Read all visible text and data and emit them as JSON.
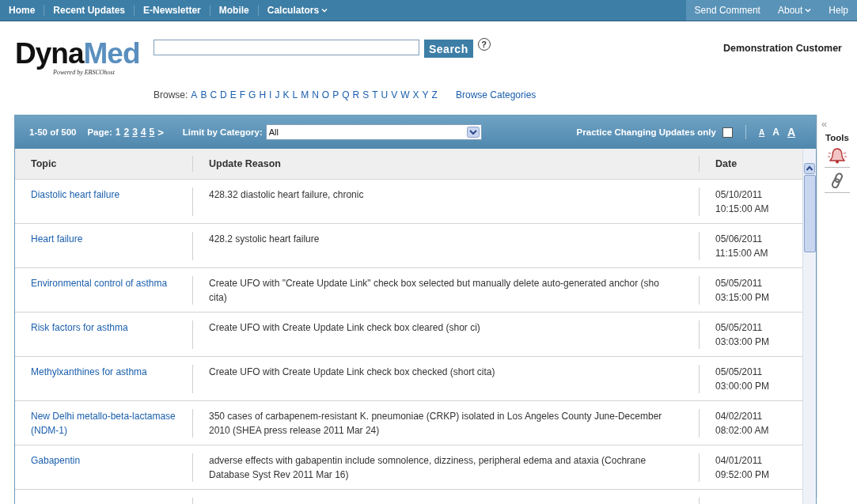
{
  "nav": {
    "left": [
      {
        "label": "Home",
        "dropdown": false
      },
      {
        "label": "Recent Updates",
        "dropdown": false
      },
      {
        "label": "E-Newsletter",
        "dropdown": false
      },
      {
        "label": "Mobile",
        "dropdown": false
      },
      {
        "label": "Calculators",
        "dropdown": true
      }
    ],
    "right": [
      {
        "label": "Send Comment",
        "dropdown": false
      },
      {
        "label": "About",
        "dropdown": true
      },
      {
        "label": "Help",
        "dropdown": false
      }
    ]
  },
  "logo": {
    "name_dark": "Dyna",
    "name_light": "Med",
    "tagline": "Powered by EBSCOhost"
  },
  "search": {
    "button": "Search",
    "help": "?"
  },
  "customer": "Demonstration Customer",
  "browse": {
    "label": "Browse:",
    "letters": [
      "A",
      "B",
      "C",
      "D",
      "E",
      "F",
      "G",
      "H",
      "I",
      "J",
      "K",
      "L",
      "M",
      "N",
      "O",
      "P",
      "Q",
      "R",
      "S",
      "T",
      "U",
      "V",
      "W",
      "X",
      "Y",
      "Z"
    ],
    "categories": "Browse Categories"
  },
  "toolbar": {
    "range": "1-50 of 500",
    "page_label": "Page:",
    "pages": [
      {
        "label": "1",
        "selected": true
      },
      {
        "label": "2",
        "selected": false
      },
      {
        "label": "3",
        "selected": false
      },
      {
        "label": "4",
        "selected": false
      },
      {
        "label": "5",
        "selected": false
      }
    ],
    "next": ">",
    "limit_label": "Limit by Category:",
    "category": "All",
    "practice_label": "Practice Changing Updates only",
    "practice_checked": false,
    "font_sizes": [
      "A",
      "A",
      "A"
    ]
  },
  "table": {
    "columns": [
      "Topic",
      "Update Reason",
      "Date"
    ],
    "rows": [
      {
        "topic": "Diastolic heart failure",
        "reason": "428.32 diastolic heart failure, chronic",
        "date": "05/10/2011",
        "time": "10:15:00 AM"
      },
      {
        "topic": "Heart failure",
        "reason": "428.2 systolic heart failure",
        "date": "05/06/2011",
        "time": "11:15:00 AM"
      },
      {
        "topic": "Environmental control of asthma",
        "reason": "Create UFO with \"Create Update Link\" check box selected but manually delete auto-generated anchor (sho cita)",
        "date": "05/05/2011",
        "time": "03:15:00 PM"
      },
      {
        "topic": "Risk factors for asthma",
        "reason": "Create UFO with Create Update Link check box cleared (shor ci)",
        "date": "05/05/2011",
        "time": "03:03:00 PM"
      },
      {
        "topic": "Methylxanthines for asthma",
        "reason": "Create UFO with Create Update Link check box checked (short cita)",
        "date": "05/05/2011",
        "time": "03:00:00 PM"
      },
      {
        "topic": "New Delhi metallo-beta-lactamase (NDM-1)",
        "reason": "350 cases of carbapenem-resistant K. pneumoniae (CRKP) isolated in Los Angeles County June-December 2010 (SHEA press release 2011 Mar 24)",
        "date": "04/02/2011",
        "time": "08:02:00 AM"
      },
      {
        "topic": "Gabapentin",
        "reason": "adverse effects with gabapentin include somnolence, dizziness, peripheral edema and ataxia (Cochrane Database Syst Rev 2011 Mar 16)",
        "date": "04/01/2011",
        "time": "09:52:00 PM"
      }
    ]
  },
  "tools": {
    "collapse": "«",
    "title": "Tools"
  }
}
